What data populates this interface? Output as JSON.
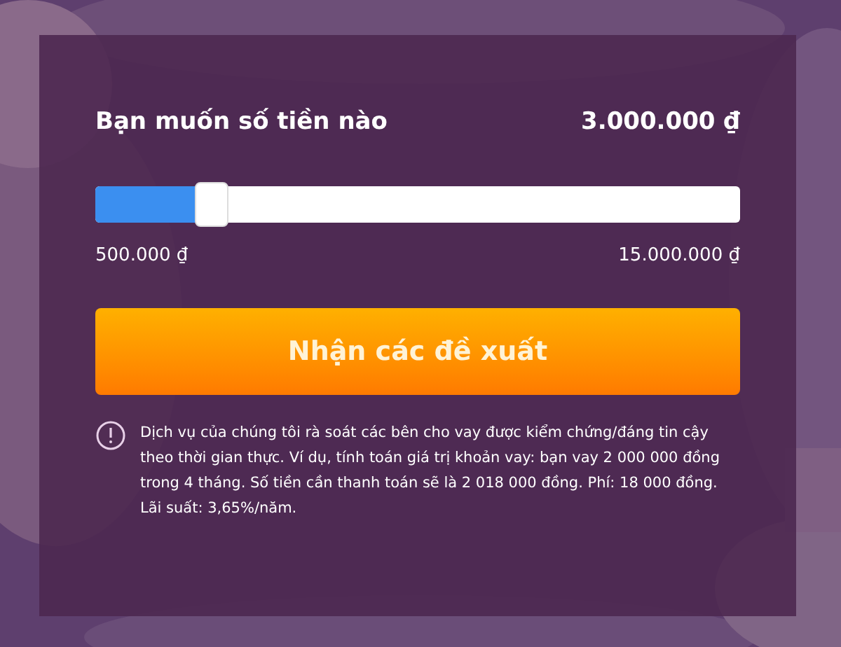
{
  "amount": {
    "label": "Bạn muốn số tiền nào",
    "value": "3.000.000 ₫"
  },
  "slider": {
    "level": 0.18,
    "min_label": "500.000 ₫",
    "max_label": "15.000.000 ₫"
  },
  "submit_button": "Nhận các đề xuất",
  "notice": "Dịch vụ của chúng tôi rà soát các bên cho vay được kiểm chứng/đáng tin cậy theo thời gian thực. Ví dụ, tính toán giá trị khoản vay: bạn vay 2 000 000 đồng trong 4 tháng. Số tiền cần thanh toán sẽ là 2 018 000 đồng. Phí: 18 000 đồng. Lãi suất: 3,65%/năm."
}
